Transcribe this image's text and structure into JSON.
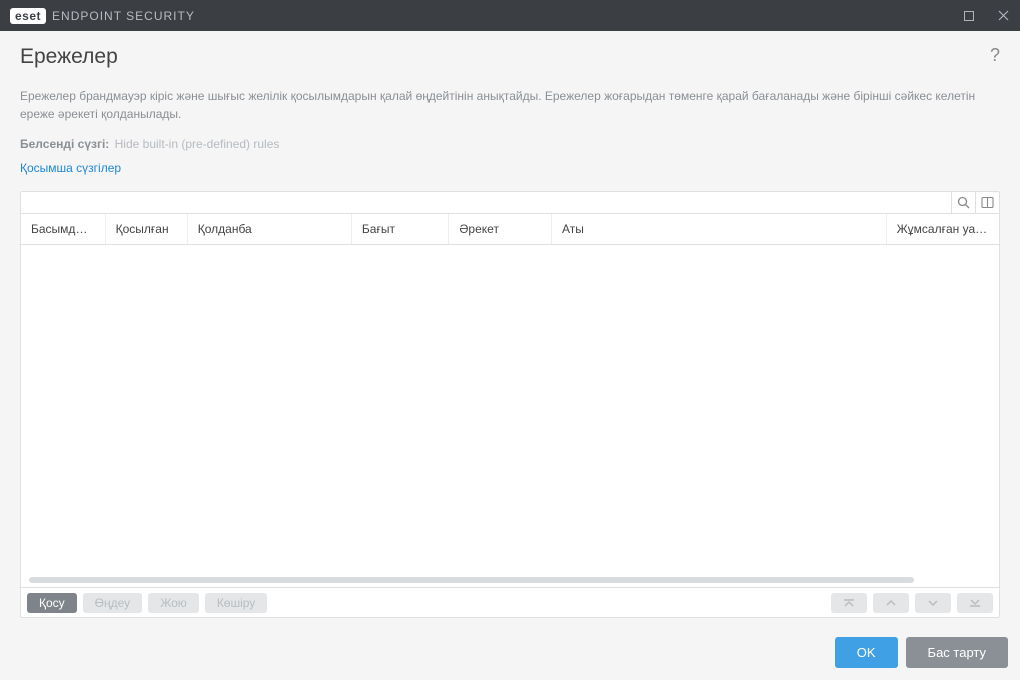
{
  "window": {
    "brand_short": "eset",
    "brand_product": "ENDPOINT SECURITY"
  },
  "page": {
    "title": "Ережелер",
    "description": "Ережелер брандмауэр кіріс және шығыс желілік қосылымдарын қалай өңдейтінін анықтайды. Ережелер жоғарыдан төменге қарай бағаланады және бірінші сәйкес келетін ереже әрекеті қолданылады.",
    "active_filter_label": "Белсенді сүзгі:",
    "active_filter_value": "Hide built-in (pre-defined) rules",
    "extra_filters_link": "Қосымша сүзгілер"
  },
  "table": {
    "columns": {
      "priority": "Басымдыл...",
      "enabled": "Қосылған",
      "application": "Қолданба",
      "direction": "Бағыт",
      "action": "Әрекет",
      "name": "Аты",
      "time": "Жұмсалған уақыт"
    },
    "rows": []
  },
  "actions": {
    "add": "Қосу",
    "edit": "Өңдеу",
    "delete": "Жою",
    "copy": "Көшіру"
  },
  "footer": {
    "ok": "OK",
    "cancel": "Бас тарту"
  }
}
